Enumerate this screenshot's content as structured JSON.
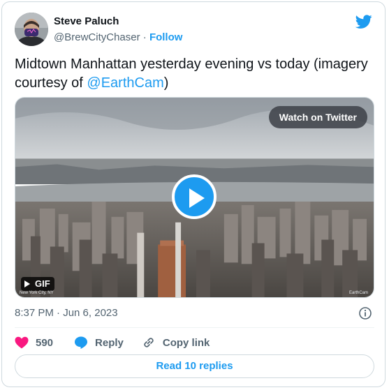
{
  "author": {
    "name": "Steve Paluch",
    "handle": "@BrewCityChaser",
    "separator": "·",
    "follow_label": "Follow"
  },
  "tweet": {
    "text_before": "Midtown Manhattan yesterday evening vs today (imagery courtesy of ",
    "mention": "@EarthCam",
    "text_after": ")"
  },
  "media": {
    "watch_label": "Watch on Twitter",
    "gif_label": "GIF",
    "watermark_left": "New York City, NY",
    "watermark_right": "EarthCam"
  },
  "meta": {
    "timestamp": "8:37 PM · Jun 6, 2023"
  },
  "actions": {
    "likes": "590",
    "reply_label": "Reply",
    "copy_label": "Copy link"
  },
  "replies_button": "Read 10 replies",
  "colors": {
    "accent": "#1d9bf0",
    "like": "#f91880",
    "text": "#0f1419",
    "secondary": "#536471"
  },
  "icons": {
    "brand": "twitter-bird-icon",
    "play": "play-icon",
    "info": "info-icon",
    "like": "heart-icon",
    "reply": "speech-bubble-icon",
    "copy": "link-icon"
  }
}
